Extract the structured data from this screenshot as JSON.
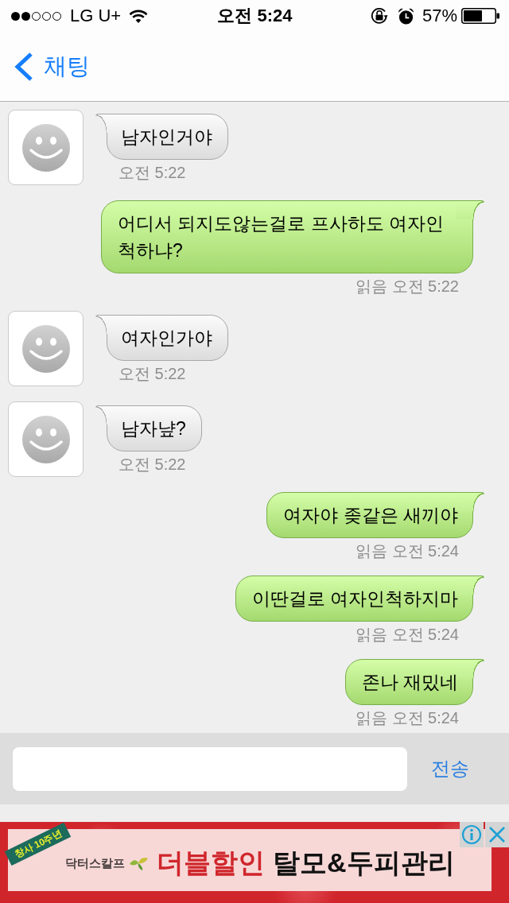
{
  "status_bar": {
    "carrier": "LG U+",
    "time": "오전 5:24",
    "battery": "57%"
  },
  "nav_bar": {
    "back_label": "채팅"
  },
  "messages": [
    {
      "kind": "incoming",
      "text": "남자인거야",
      "timestamp": "오전 5:22"
    },
    {
      "kind": "outgoing",
      "text": "어디서 되지도않는걸로 프사하도 여자인 척하냐?",
      "timestamp": "읽음 오전 5:22"
    },
    {
      "kind": "incoming",
      "text": "여자인가야",
      "timestamp": "오전 5:22"
    },
    {
      "kind": "incoming",
      "text": "남자냪?",
      "timestamp": "오전 5:22"
    },
    {
      "kind": "outgoing",
      "text": "여자야 좆같은 새끼야",
      "timestamp": "읽음 오전 5:24"
    },
    {
      "kind": "outgoing",
      "text": "이딴걸로 여자인척하지마",
      "timestamp": "읽음 오전 5:24"
    },
    {
      "kind": "outgoing",
      "text": "존나 재밌네",
      "timestamp": "읽음 오전 5:24"
    }
  ],
  "composer": {
    "send_label": "전송"
  },
  "ad": {
    "ribbon": "창사 10주년",
    "brand": "닥터스칼프",
    "headline": "더블할인",
    "tagline": "탈모&두피관리"
  }
}
